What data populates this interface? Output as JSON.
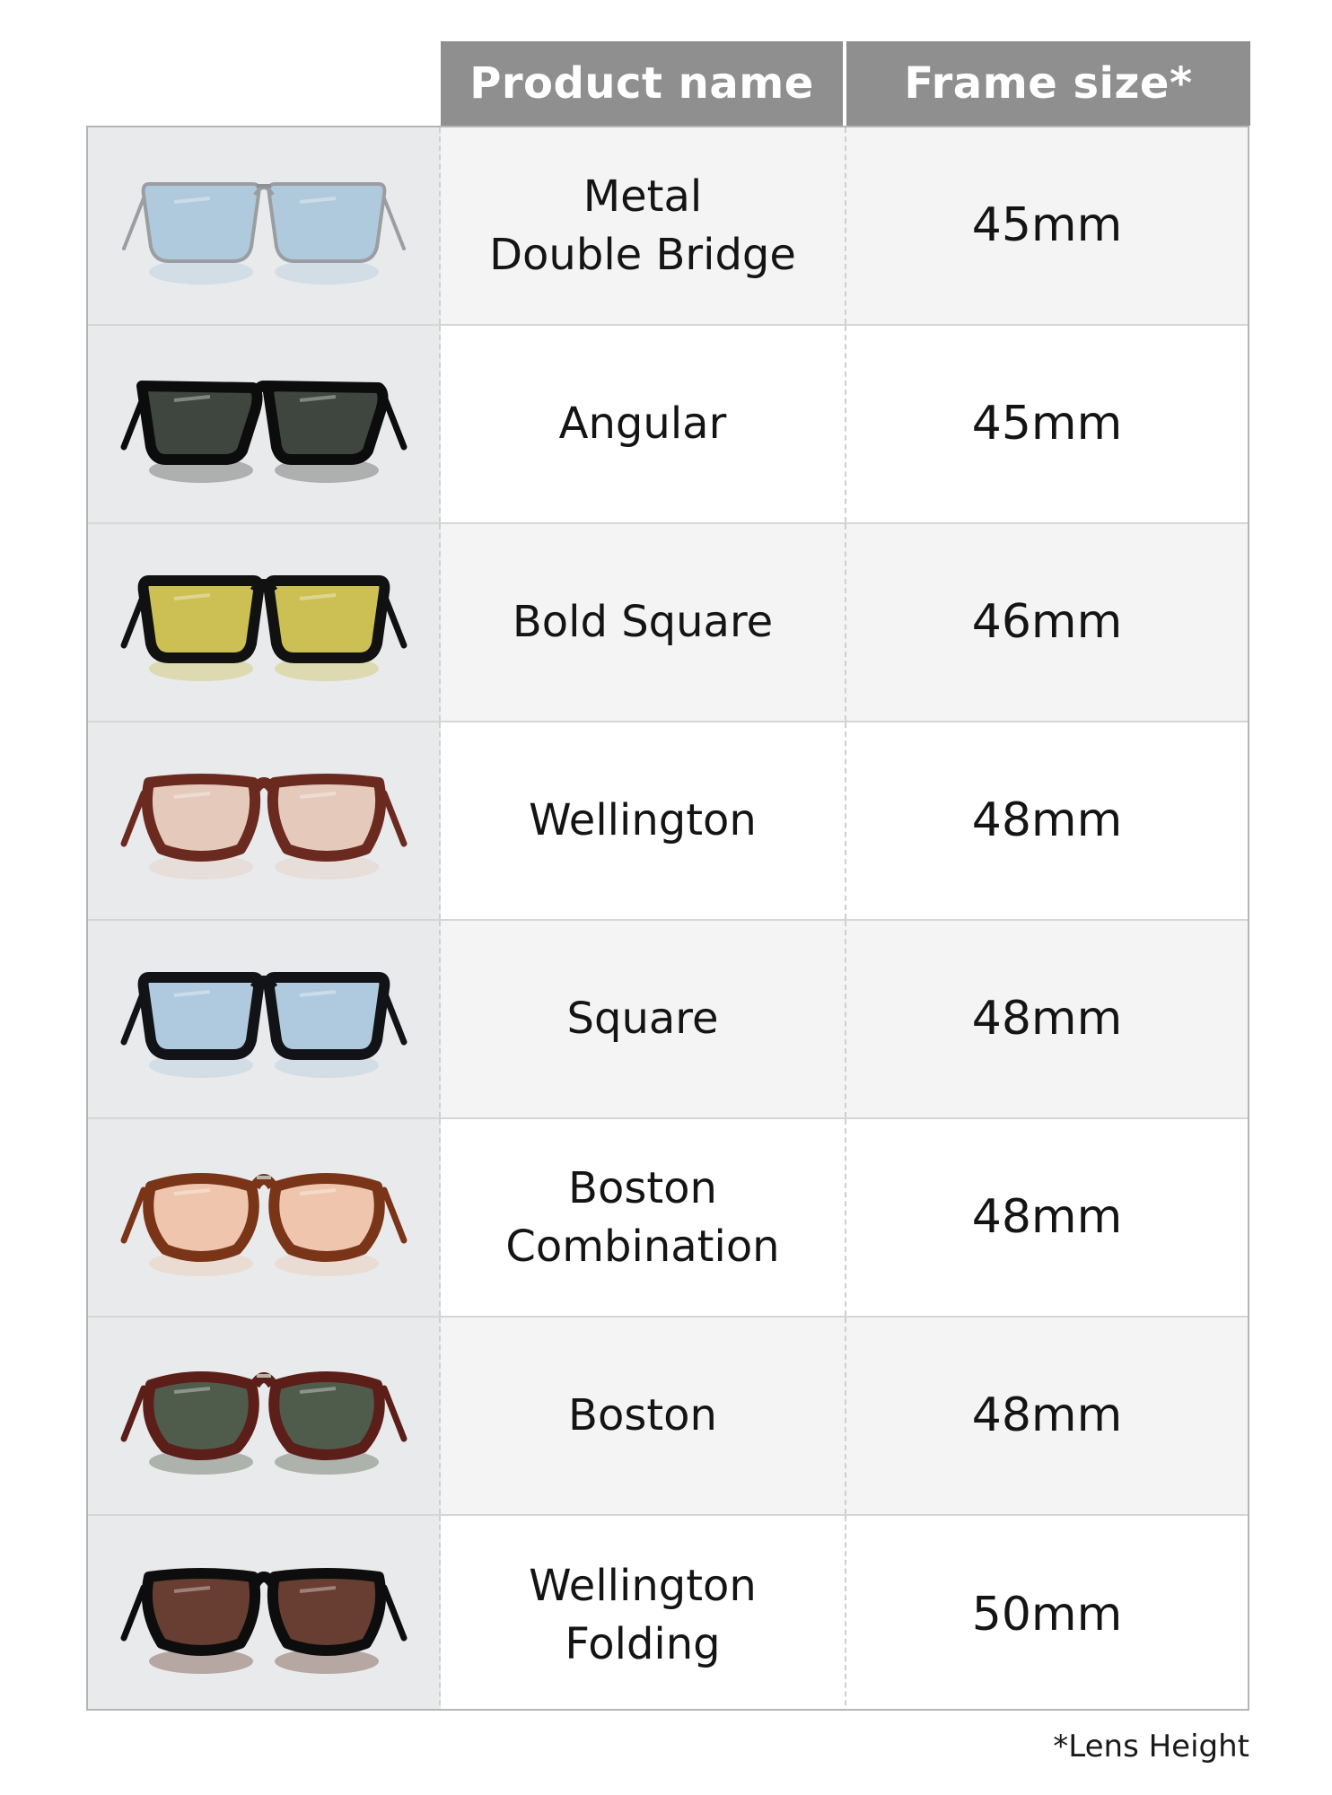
{
  "header": {
    "product_name": "Product name",
    "frame_size": "Frame size*"
  },
  "rows": [
    {
      "name": "Metal\nDouble Bridge",
      "size": "45mm",
      "lens": "#a9c6dc",
      "frame": "#9a9ea3",
      "style": "metal"
    },
    {
      "name": "Angular",
      "size": "45mm",
      "lens": "#3e463f",
      "frame": "#0c0c0c",
      "style": "angular"
    },
    {
      "name": "Bold Square",
      "size": "46mm",
      "lens": "#c9bb45",
      "frame": "#111111",
      "style": "square"
    },
    {
      "name": "Wellington",
      "size": "48mm",
      "lens": "#e4c7b7",
      "frame": "#6b2a20",
      "style": "wellington"
    },
    {
      "name": "Square",
      "size": "48mm",
      "lens": "#a8c7de",
      "frame": "#121316",
      "style": "square"
    },
    {
      "name": "Boston\nCombination",
      "size": "48mm",
      "lens": "#efc2a6",
      "frame": "#7a3518",
      "style": "boston"
    },
    {
      "name": "Boston",
      "size": "48mm",
      "lens": "#3e4b3a",
      "frame": "#5b1e18",
      "style": "boston"
    },
    {
      "name": "Wellington\nFolding",
      "size": "50mm",
      "lens": "#5a2a1e",
      "frame": "#0d0d0d",
      "style": "wellington"
    }
  ],
  "footnote": "*Lens Height"
}
